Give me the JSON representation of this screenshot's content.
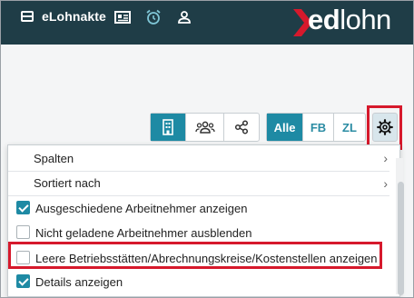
{
  "header": {
    "app_title": "eLohnakte",
    "logo_text_bold": "ed",
    "logo_text_light": "lohn",
    "nav_icons": [
      "employee-card-icon",
      "alarm-clock-icon",
      "user-icon"
    ]
  },
  "toolbar": {
    "view_buttons": [
      "building-icon",
      "people-group-icon",
      "share-icon"
    ],
    "filter_buttons": [
      {
        "label": "Alle",
        "active": true
      },
      {
        "label": "FB",
        "active": false
      },
      {
        "label": "ZL",
        "active": false
      }
    ],
    "settings_icon": "gear-icon"
  },
  "menu": {
    "submenus": [
      {
        "label": "Spalten"
      },
      {
        "label": "Sortiert nach"
      }
    ],
    "options": [
      {
        "label": "Ausgeschiedene Arbeitnehmer anzeigen",
        "checked": true
      },
      {
        "label": "Nicht geladene Arbeitnehmer ausblenden",
        "checked": false
      },
      {
        "label": "Leere Betriebsstätten/Abrechnungskreise/Kostenstellen anzeigen",
        "checked": false
      },
      {
        "label": "Details anzeigen",
        "checked": true
      }
    ]
  },
  "colors": {
    "topbar": "#1f3d47",
    "accent": "#1e8aa4",
    "highlight": "#d6192c",
    "logo_chevron": "#d6192c"
  }
}
